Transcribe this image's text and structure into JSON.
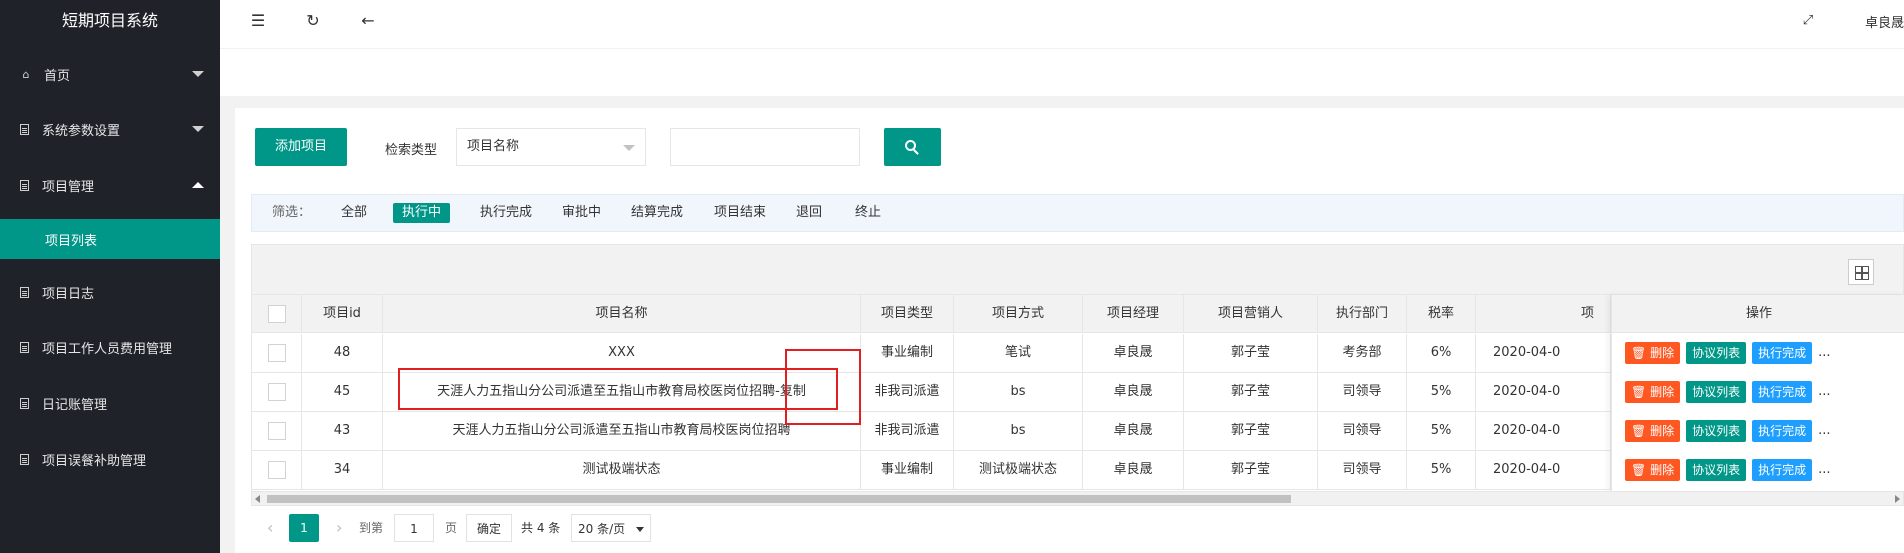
{
  "sidebar": {
    "title": "短期项目系统",
    "items": [
      {
        "label": "首页"
      },
      {
        "label": "系统参数设置"
      },
      {
        "label": "项目管理"
      },
      {
        "label": "项目列表"
      },
      {
        "label": "项目日志"
      },
      {
        "label": "项目工作人员费用管理"
      },
      {
        "label": "日记账管理"
      },
      {
        "label": "项目误餐补助管理"
      }
    ]
  },
  "topbar": {
    "user": "卓良晟"
  },
  "toolbar": {
    "add_label": "添加项目",
    "search_type_label": "检索类型",
    "search_type_value": "项目名称",
    "search_input_value": ""
  },
  "filter": {
    "label": "筛选：",
    "items": [
      "全部",
      "执行中",
      "执行完成",
      "审批中",
      "结算完成",
      "项目结束",
      "退回",
      "终止"
    ],
    "active": "执行中"
  },
  "table": {
    "columns": [
      "项目id",
      "项目名称",
      "项目类型",
      "项目方式",
      "项目经理",
      "项目营销人",
      "执行部门",
      "税率",
      "项",
      "操作"
    ],
    "rows": [
      {
        "id": "48",
        "name": "XXX",
        "type": "事业编制",
        "method": "笔试",
        "manager": "卓良晟",
        "marketer": "郭子莹",
        "dept": "考务部",
        "tax": "6%",
        "date": "2020-04-0"
      },
      {
        "id": "45",
        "name": "天涯人力五指山分公司派遣至五指山市教育局校医岗位招聘-复制",
        "type": "非我司派遣",
        "method": "bs",
        "manager": "卓良晟",
        "marketer": "郭子莹",
        "dept": "司领导",
        "tax": "5%",
        "date": "2020-04-0"
      },
      {
        "id": "43",
        "name": "天涯人力五指山分公司派遣至五指山市教育局校医岗位招聘",
        "type": "非我司派遣",
        "method": "bs",
        "manager": "卓良晟",
        "marketer": "郭子莹",
        "dept": "司领导",
        "tax": "5%",
        "date": "2020-04-0"
      },
      {
        "id": "34",
        "name": "测试极端状态",
        "type": "事业编制",
        "method": "测试极端状态",
        "manager": "卓良晟",
        "marketer": "郭子莹",
        "dept": "司领导",
        "tax": "5%",
        "date": "2020-04-0"
      }
    ],
    "ops": {
      "delete": "删除",
      "list": "协议列表",
      "done": "执行完成",
      "more": "..."
    }
  },
  "pager": {
    "current": "1",
    "goto_label": "到第",
    "goto_value": "1",
    "page_unit": "页",
    "confirm": "确定",
    "total": "共 4 条",
    "page_size": "20 条/页"
  },
  "colors": {
    "sidebar_bg": "#20222a",
    "accent": "#009688",
    "delete": "#ff5722",
    "done": "#1e9fff",
    "highlight": "#e02020"
  }
}
